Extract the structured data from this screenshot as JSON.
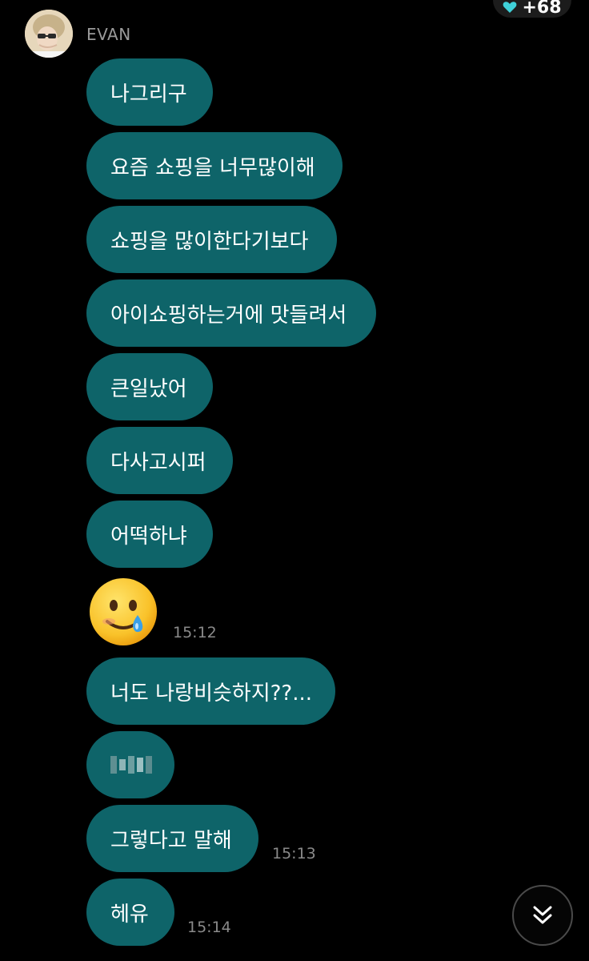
{
  "header": {
    "badge_count": "+68",
    "sender_name": "EVAN"
  },
  "messages": [
    {
      "text": "나그리구"
    },
    {
      "text": "요즘 쇼핑을 너무많이해"
    },
    {
      "text": "쇼핑을 많이한다기보다"
    },
    {
      "text": "아이쇼핑하는거에 맛들려서"
    },
    {
      "text": "큰일났어"
    },
    {
      "text": "다사고시퍼"
    },
    {
      "text": "어떡하냐"
    },
    {
      "emoji": "smiling-face-with-tear",
      "time": "15:12"
    },
    {
      "text": "너도 나랑비슷하지??..."
    },
    {
      "text": "",
      "censored": true
    },
    {
      "text": "그렇다고 말해",
      "time": "15:13"
    },
    {
      "text": "헤유",
      "time": "15:14"
    }
  ],
  "colors": {
    "background": "#000000",
    "bubble": "#0e6469",
    "timestamp": "#8a8a8a",
    "sender": "#9a9a9a"
  },
  "icons": {
    "badge": "heart-icon",
    "scroll": "double-chevron-down-icon"
  }
}
